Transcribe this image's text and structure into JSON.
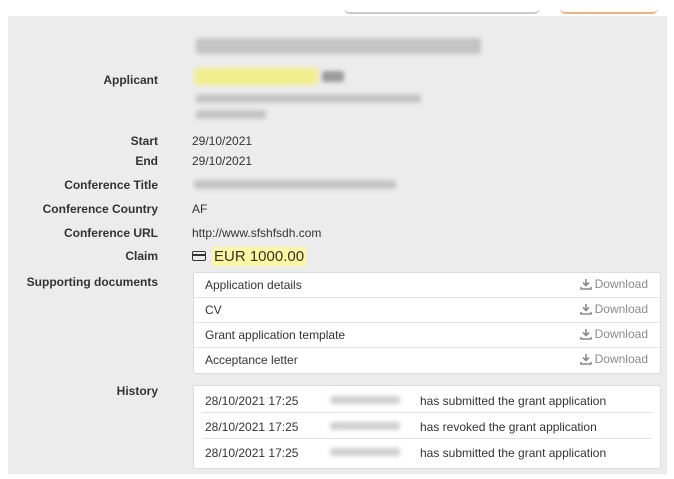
{
  "labels": {
    "applicant": "Applicant",
    "start": "Start",
    "end": "End",
    "conference_title": "Conference Title",
    "conference_country": "Conference Country",
    "conference_url": "Conference URL",
    "claim": "Claim",
    "supporting_documents": "Supporting documents",
    "history": "History"
  },
  "values": {
    "start": "29/10/2021",
    "end": "29/10/2021",
    "conference_country": "AF",
    "conference_url": "http://www.sfshfsdh.com",
    "claim_amount": "EUR 1000.00"
  },
  "documents": [
    {
      "name": "Application details",
      "action": "Download"
    },
    {
      "name": "CV",
      "action": "Download"
    },
    {
      "name": "Grant application template",
      "action": "Download"
    },
    {
      "name": "Acceptance letter",
      "action": "Download"
    }
  ],
  "history": [
    {
      "time": "28/10/2021 17:25",
      "action": "has submitted the grant application"
    },
    {
      "time": "28/10/2021 17:25",
      "action": "has revoked the grant application"
    },
    {
      "time": "28/10/2021 17:25",
      "action": "has submitted the grant application"
    }
  ],
  "icons": {
    "claim": "credit-card-icon",
    "download": "download-icon"
  },
  "colors": {
    "panel_bg": "#ececec",
    "highlight": "#fcf7a0",
    "download_text": "#8a8a8a"
  }
}
